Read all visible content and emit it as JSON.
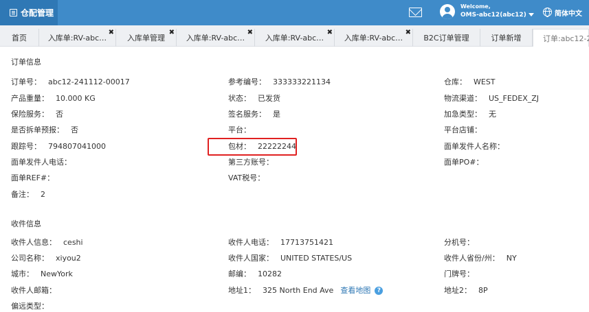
{
  "header": {
    "brand": "仓配管理",
    "welcome": "Welcome,",
    "user": "OMS-abc12(abc12)",
    "language": "简体中文"
  },
  "tabs": [
    {
      "label": "首页",
      "closable": false
    },
    {
      "label": "入库单:RV-abc…",
      "closable": true
    },
    {
      "label": "入库单管理",
      "closable": true
    },
    {
      "label": "入库单:RV-abc…",
      "closable": true
    },
    {
      "label": "入库单:RV-abc…",
      "closable": true
    },
    {
      "label": "入库单:RV-abc…",
      "closable": true
    },
    {
      "label": "B2C订单管理",
      "closable": false
    },
    {
      "label": "订单新增",
      "closable": false
    },
    {
      "label": "订单:abc12-2",
      "closable": false,
      "active": true
    }
  ],
  "order_info": {
    "title": "订单信息",
    "order_no": {
      "label": "订单号：",
      "value": "abc12-241112-00017"
    },
    "ref_no": {
      "label": "参考编号：",
      "value": "333333221134"
    },
    "warehouse": {
      "label": "仓库：",
      "value": "WEST"
    },
    "weight": {
      "label": "产品重量：",
      "value": "10.000 KG"
    },
    "status": {
      "label": "状态：",
      "value": "已发货"
    },
    "channel": {
      "label": "物流渠道：",
      "value": "US_FEDEX_ZJ"
    },
    "insurance": {
      "label": "保险服务：",
      "value": "否"
    },
    "signature": {
      "label": "签名服务：",
      "value": "是"
    },
    "fee_type": {
      "label": "加急类型：",
      "value": "无"
    },
    "split": {
      "label": "是否拆单预报：",
      "value": "否"
    },
    "platform": {
      "label": "平台：",
      "value": ""
    },
    "store": {
      "label": "平台店铺：",
      "value": ""
    },
    "tracking": {
      "label": "跟踪号：",
      "value": "794807041000"
    },
    "packaging": {
      "label": "包材：",
      "value": "22222244"
    },
    "sender_name": {
      "label": "面单发件人名称：",
      "value": ""
    },
    "sender_phone": {
      "label": "面单发件人电话：",
      "value": ""
    },
    "third_account": {
      "label": "第三方账号：",
      "value": ""
    },
    "po": {
      "label": "面单PO#：",
      "value": ""
    },
    "ref": {
      "label": "面单REF#：",
      "value": ""
    },
    "vat": {
      "label": "VAT税号：",
      "value": ""
    },
    "remark": {
      "label": "备注：",
      "value": "2"
    }
  },
  "receiver_info": {
    "title": "收件信息",
    "name": {
      "label": "收件人信息：",
      "value": "ceshi"
    },
    "phone": {
      "label": "收件人电话：",
      "value": "17713751421"
    },
    "ext": {
      "label": "分机号：",
      "value": ""
    },
    "company": {
      "label": "公司名称：",
      "value": "xiyou2"
    },
    "country": {
      "label": "收件人国家：",
      "value": "UNITED STATES/US"
    },
    "state": {
      "label": "收件人省份/州：",
      "value": "NY"
    },
    "city": {
      "label": "城市：",
      "value": "NewYork"
    },
    "zip": {
      "label": "邮编：",
      "value": "10282"
    },
    "door": {
      "label": "门牌号：",
      "value": ""
    },
    "email": {
      "label": "收件人邮箱：",
      "value": ""
    },
    "address1": {
      "label": "地址1：",
      "value": "325 North End Ave",
      "map_link": "查看地图"
    },
    "address2": {
      "label": "地址2：",
      "value": "8P"
    },
    "remote": {
      "label": "偏远类型：",
      "value": ""
    }
  },
  "colors": {
    "topbar": "#3f8bc9",
    "brand_bg": "#2f78b5",
    "highlight": "#e02020",
    "link": "#2f78b5"
  }
}
